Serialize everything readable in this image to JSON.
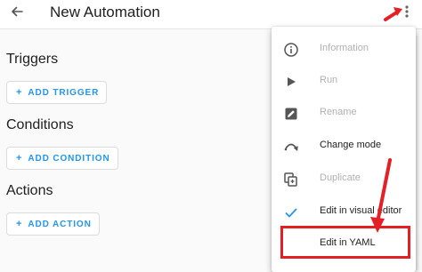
{
  "header": {
    "title": "New Automation",
    "back_icon": "arrow-left-icon",
    "menu_icon": "dots-vertical-icon"
  },
  "sections": [
    {
      "title": "Triggers",
      "button_label": "ADD TRIGGER"
    },
    {
      "title": "Conditions",
      "button_label": "ADD CONDITION"
    },
    {
      "title": "Actions",
      "button_label": "ADD ACTION"
    }
  ],
  "menu": {
    "items": [
      {
        "label": "Information",
        "icon": "info-icon",
        "enabled": false
      },
      {
        "label": "Run",
        "icon": "play-icon",
        "enabled": false
      },
      {
        "label": "Rename",
        "icon": "rename-icon",
        "enabled": false
      },
      {
        "label": "Change mode",
        "icon": "change-mode-icon",
        "enabled": true
      },
      {
        "label": "Duplicate",
        "icon": "duplicate-icon",
        "enabled": false
      },
      {
        "label": "Edit in visual editor",
        "icon": "check-icon",
        "enabled": true,
        "checked": true
      },
      {
        "label": "Edit in YAML",
        "icon": "",
        "enabled": true
      }
    ]
  },
  "colors": {
    "accent": "#2196f3",
    "annotation": "#e42025",
    "disabled_text": "#b0b0b0"
  }
}
